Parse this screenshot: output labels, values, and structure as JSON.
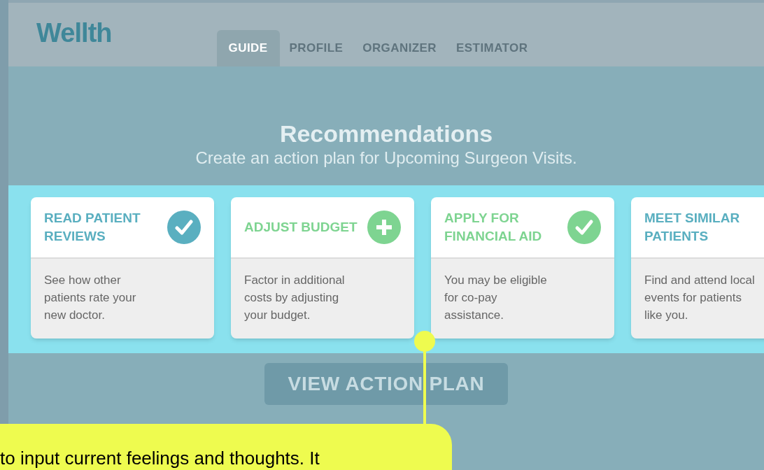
{
  "header": {
    "logo": "Wellth",
    "tabs": [
      {
        "label": "GUIDE",
        "selected": true
      },
      {
        "label": "PROFILE",
        "selected": false
      },
      {
        "label": "ORGANIZER",
        "selected": false
      },
      {
        "label": "ESTIMATOR",
        "selected": false
      }
    ]
  },
  "title": "Recommendations",
  "subtitle": "Create an action plan for Upcoming Surgeon Visits.",
  "cards": [
    {
      "title": "READ PATIENT REVIEWS",
      "body": "See how other patients rate your new doctor.",
      "color": "#5aafc0",
      "kind": "check"
    },
    {
      "title": "ADJUST BUDGET",
      "body": "Factor in additional costs by adjusting your budget.",
      "color": "#7ed491",
      "kind": "add"
    },
    {
      "title": "APPLY FOR FINANCIAL AID",
      "body": "You may be eligible for co-pay assistance.",
      "color": "#7ed491",
      "kind": "check"
    },
    {
      "title": "MEET SIMILAR PATIENTS",
      "body": "Find and attend local events for patients like you.",
      "color": "#5aafc0",
      "kind": "none"
    }
  ],
  "action_button": "VIEW ACTION PLAN",
  "callout": "to input current feelings and thoughts. It"
}
